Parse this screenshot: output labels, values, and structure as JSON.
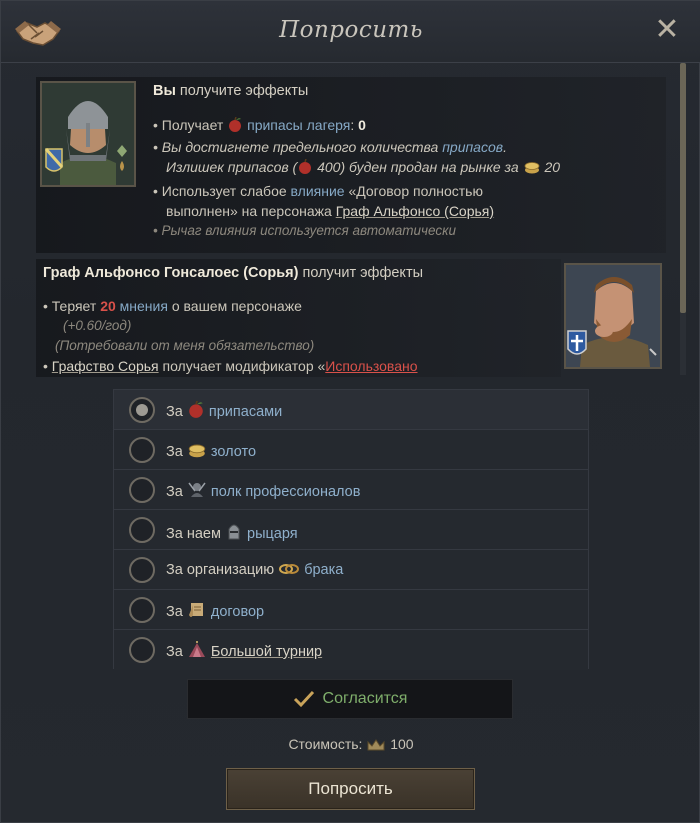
{
  "window": {
    "title": "Попросить",
    "close_icon": "close-icon",
    "header_icon": "handshake-icon"
  },
  "my_effects": {
    "heading_bold": "Вы",
    "heading_rest": " получите эффекты",
    "line1_pre": "• Получает ",
    "line1_blue": "припасы лагеря",
    "line1_post": ": ",
    "line1_value": "0",
    "line2_pre": "• Вы достигнете предельного количества ",
    "line2_blue": "припасов",
    "line2_post": ".",
    "line3_pre": "Излишек припасов (",
    "line3_num": "400",
    "line3_mid": ") буден продан на рынке за ",
    "line3_val": "20",
    "line4_pre": "• Использует слабое ",
    "line4_blue": "влияние",
    "line4_post": " «Договор полностью",
    "line5_pre": "выполнен» на персонажа ",
    "line5_link": "Граф Альфонсо (Сорья)",
    "line6": "• Рычаг влияния используется автоматически"
  },
  "count_effects": {
    "heading_bold": "Граф Альфонсо Гонсалоес (Сорья)",
    "heading_rest": " получит эффекты",
    "line1_pre": "• Теряет ",
    "line1_num": "20",
    "line1_blue": " мнения",
    "line1_post": " о вашем персонаже",
    "line2": "(+0.60/год)",
    "line3": "(Потребовали от меня обязательство)",
    "line4_pre": "• ",
    "line4_link": "Графство Сорья",
    "line4_mid": " получает модификатор «",
    "line4_red": "Использовано"
  },
  "options": [
    {
      "pre": "За ",
      "icon": "apple-icon",
      "label": "припасами",
      "selected": true
    },
    {
      "pre": "За ",
      "icon": "gold-icon",
      "label": "золото",
      "selected": false
    },
    {
      "pre": "За ",
      "icon": "soldiers-icon",
      "label": "полк профессионалов",
      "selected": false
    },
    {
      "pre": "За наем ",
      "icon": "knight-helmet-icon",
      "label": "рыцаря",
      "selected": false
    },
    {
      "pre": "За организацию ",
      "icon": "rings-icon",
      "label": "брака",
      "selected": false
    },
    {
      "pre": "За ",
      "icon": "scroll-icon",
      "label": "договор",
      "selected": false
    },
    {
      "pre": "За ",
      "icon": "tournament-icon",
      "label": "Большой турнир",
      "selected": false
    }
  ],
  "agree": {
    "label": "Согласится",
    "icon": "checkmark-icon"
  },
  "cost": {
    "label": "Стоимость:",
    "value": "100",
    "icon": "crown-icon"
  },
  "ask_button": {
    "label": "Попросить"
  },
  "colors": {
    "accent_blue": "#86a9c6",
    "negative_red": "#d9514a",
    "agree_green": "#7fae6b"
  }
}
